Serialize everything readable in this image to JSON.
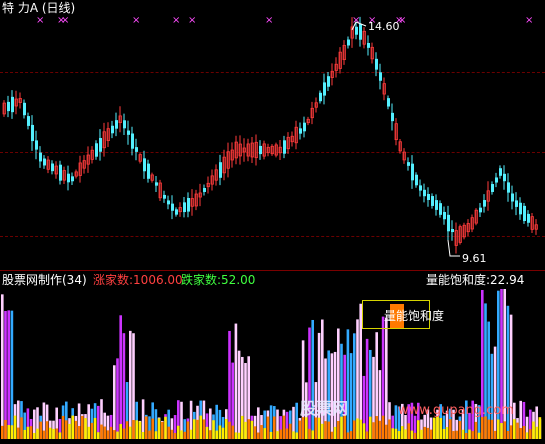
{
  "upper_panel": {
    "title": "特  力A (日线)",
    "high_label": "14.60",
    "low_label": "9.61"
  },
  "lower_panel": {
    "title": "股票网制作(34)",
    "rise_label": "涨家数:1006.00",
    "fall_label": "跌家数:52.00",
    "saturation_label": "量能饱和度:22.94",
    "legend_label": "量能饱和度"
  },
  "watermark": {
    "text": "股票网",
    "url": "www.gupang.com"
  },
  "colors": {
    "up_candle": "#ff3b3b",
    "down_candle": "#54f0ff",
    "magenta_marker": "#ff4dff",
    "rise_text": "#ff4040",
    "fall_text": "#40ff40",
    "title_text": "#ffffff",
    "saturation_text": "#ffffff",
    "bar_pink": "#ffd0ff",
    "bar_magenta": "#cc33ff",
    "bar_cyan": "#33aaff",
    "bar_yellow": "#ffee00",
    "bar_orange": "#ff7a00"
  }
}
